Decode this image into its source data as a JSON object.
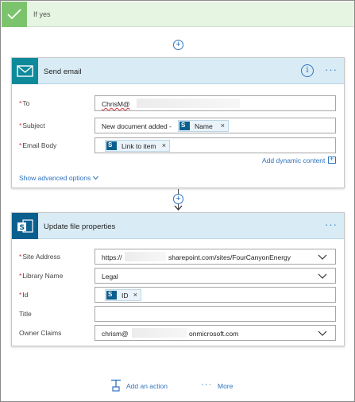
{
  "ifyes": {
    "label": "If yes"
  },
  "send_email": {
    "title": "Send email",
    "fields": {
      "to_label": "To",
      "to_value": "ChrisM@",
      "subject_label": "Subject",
      "subject_prefix": "New document added -",
      "subject_token": "Name",
      "body_label": "Email Body",
      "body_token": "Link to item"
    },
    "add_dynamic": "Add dynamic content",
    "show_advanced": "Show advanced options"
  },
  "update_file": {
    "title": "Update file properties",
    "fields": {
      "site_label": "Site Address",
      "site_prefix": "https://",
      "site_suffix": "sharepoint.com/sites/FourCanyonEnergy",
      "library_label": "Library Name",
      "library_value": "Legal",
      "id_label": "Id",
      "id_token": "ID",
      "title_label": "Title",
      "owner_label": "Owner Claims",
      "owner_prefix": "chrism@",
      "owner_suffix": "onmicrosoft.com"
    }
  },
  "actions": {
    "add_action": "Add an action",
    "more": "More"
  },
  "symbols": {
    "plus": "+",
    "dots": "···",
    "info": "i",
    "close": "×",
    "required": "*",
    "sharepoint_letter": "S"
  },
  "colors": {
    "accent": "#2f73c0",
    "ifyes_bg": "#e6f4e2",
    "check_green": "#7bc46d",
    "card_header_bg": "#d9ecf6",
    "email_tile": "#0e8a9b",
    "sharepoint_tile": "#0b5f8f",
    "required": "#d13438"
  },
  "icons": [
    "check-icon",
    "plus-circle-icon",
    "email-icon",
    "info-icon",
    "more-dots-icon",
    "sharepoint-icon",
    "close-icon",
    "chevron-down-icon",
    "add-action-icon"
  ]
}
